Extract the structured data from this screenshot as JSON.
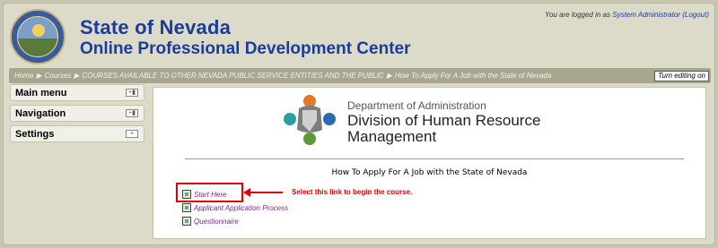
{
  "header": {
    "title": "State of Nevada",
    "subtitle": "Online Professional Development Center",
    "login_prefix": "You are logged in as",
    "user_name": "System Administrator",
    "logout_label": "(Logout)"
  },
  "breadcrumb": {
    "items": [
      "Home",
      "Courses",
      "COURSES AVAILABLE TO OTHER NEVADA PUBLIC SERVICE ENTITIES AND THE PUBLIC",
      "How To Apply For A Job with the State of Nevada"
    ],
    "separator": "▶"
  },
  "toolbar": {
    "edit_label": "Turn editing on"
  },
  "sidebar": {
    "blocks": [
      {
        "title": "Main menu",
        "icon": "+▮"
      },
      {
        "title": "Navigation",
        "icon": "+▮"
      },
      {
        "title": "Settings",
        "icon": "+"
      }
    ]
  },
  "content": {
    "department": "Department of Administration",
    "division_line1": "Division of Human Resource",
    "division_line2": "Management",
    "course_title": "How To Apply For A Job with the State of Nevada",
    "activities": [
      "Start Here",
      "Applicant Application Process",
      "Questionnaire"
    ],
    "annotation": "Select this link to begin the course."
  },
  "colors": {
    "title_blue": "#1a3d9c",
    "link_purple": "#7a2a82",
    "annotation_red": "#e00000"
  }
}
